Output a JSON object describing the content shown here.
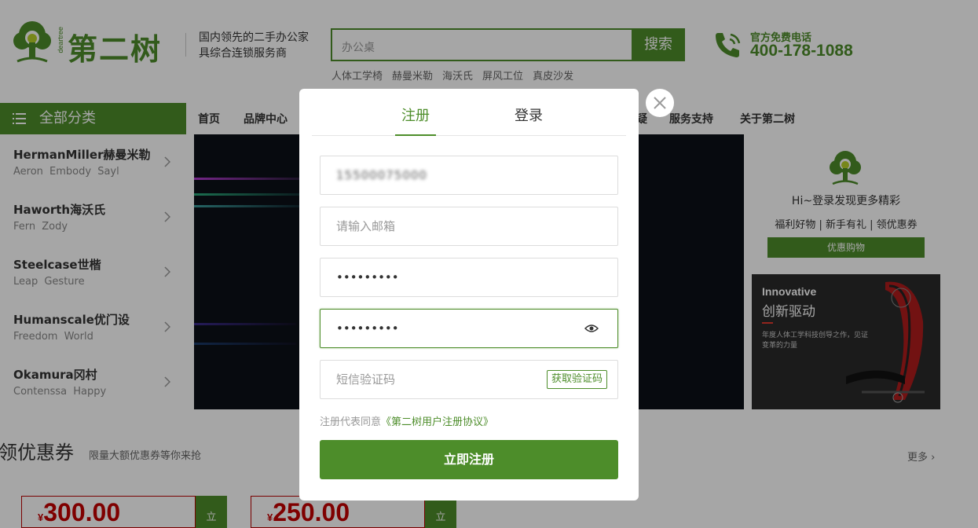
{
  "header": {
    "logo_sub": "deartree",
    "logo_text": "第二树",
    "slogan": "国内领先的二手办公家具综合连锁服务商",
    "search_placeholder": "办公桌",
    "search_button": "搜索",
    "hot_words": [
      "人体工学椅",
      "赫曼米勒",
      "海沃氏",
      "屏风工位",
      "真皮沙发"
    ],
    "hotline_label": "官方免费电话",
    "hotline_number": "400-178-1088"
  },
  "categories": {
    "title": "全部分类",
    "items": [
      {
        "name": "HermanMiller赫曼米勒",
        "sub": "Aeron Embody Sayl"
      },
      {
        "name": "Haworth海沃氏",
        "sub": "Fern Zody"
      },
      {
        "name": "Steelcase世楷",
        "sub": "Leap Gesture"
      },
      {
        "name": "Humanscale优门设",
        "sub": "Freedom World"
      },
      {
        "name": "Okamura冈村",
        "sub": "Contenssa Happy"
      }
    ]
  },
  "nav": {
    "items": [
      "首页",
      "品牌中心",
      "",
      "",
      "",
      "",
      "",
      "服务支持",
      "关于第二树"
    ],
    "partial": "疑"
  },
  "user_card": {
    "greeting": "Hi~登录发现更多精彩",
    "links": [
      "福利好物",
      "新手有礼",
      "领优惠券"
    ],
    "button": "优惠购物"
  },
  "promo": {
    "title_en": "Innovative",
    "title_cn": "创新驱动",
    "desc": "年度人体工学科技创导之作，见证变革的力量"
  },
  "coupons": {
    "title": "领优惠券",
    "subtitle": "限量大额优惠券等你来抢",
    "more": "更多",
    "currency": "¥",
    "items": [
      {
        "amount": "300.00",
        "tab": "立"
      },
      {
        "amount": "250.00",
        "tab": "立"
      }
    ]
  },
  "modal": {
    "tab_register": "注册",
    "tab_login": "登录",
    "phone_value": "15500075000",
    "email_placeholder": "请输入邮箱",
    "password_value": "•••••••••",
    "confirm_value": "•••••••••",
    "sms_placeholder": "短信验证码",
    "sms_button": "获取验证码",
    "agree_text": "注册代表同意",
    "agree_link": "《第二树用户注册协议》",
    "submit": "立即注册"
  },
  "colors": {
    "brand_green": "#4d8d2a",
    "price_red": "#c40000",
    "overlay": "rgba(0,0,0,0.35)"
  }
}
